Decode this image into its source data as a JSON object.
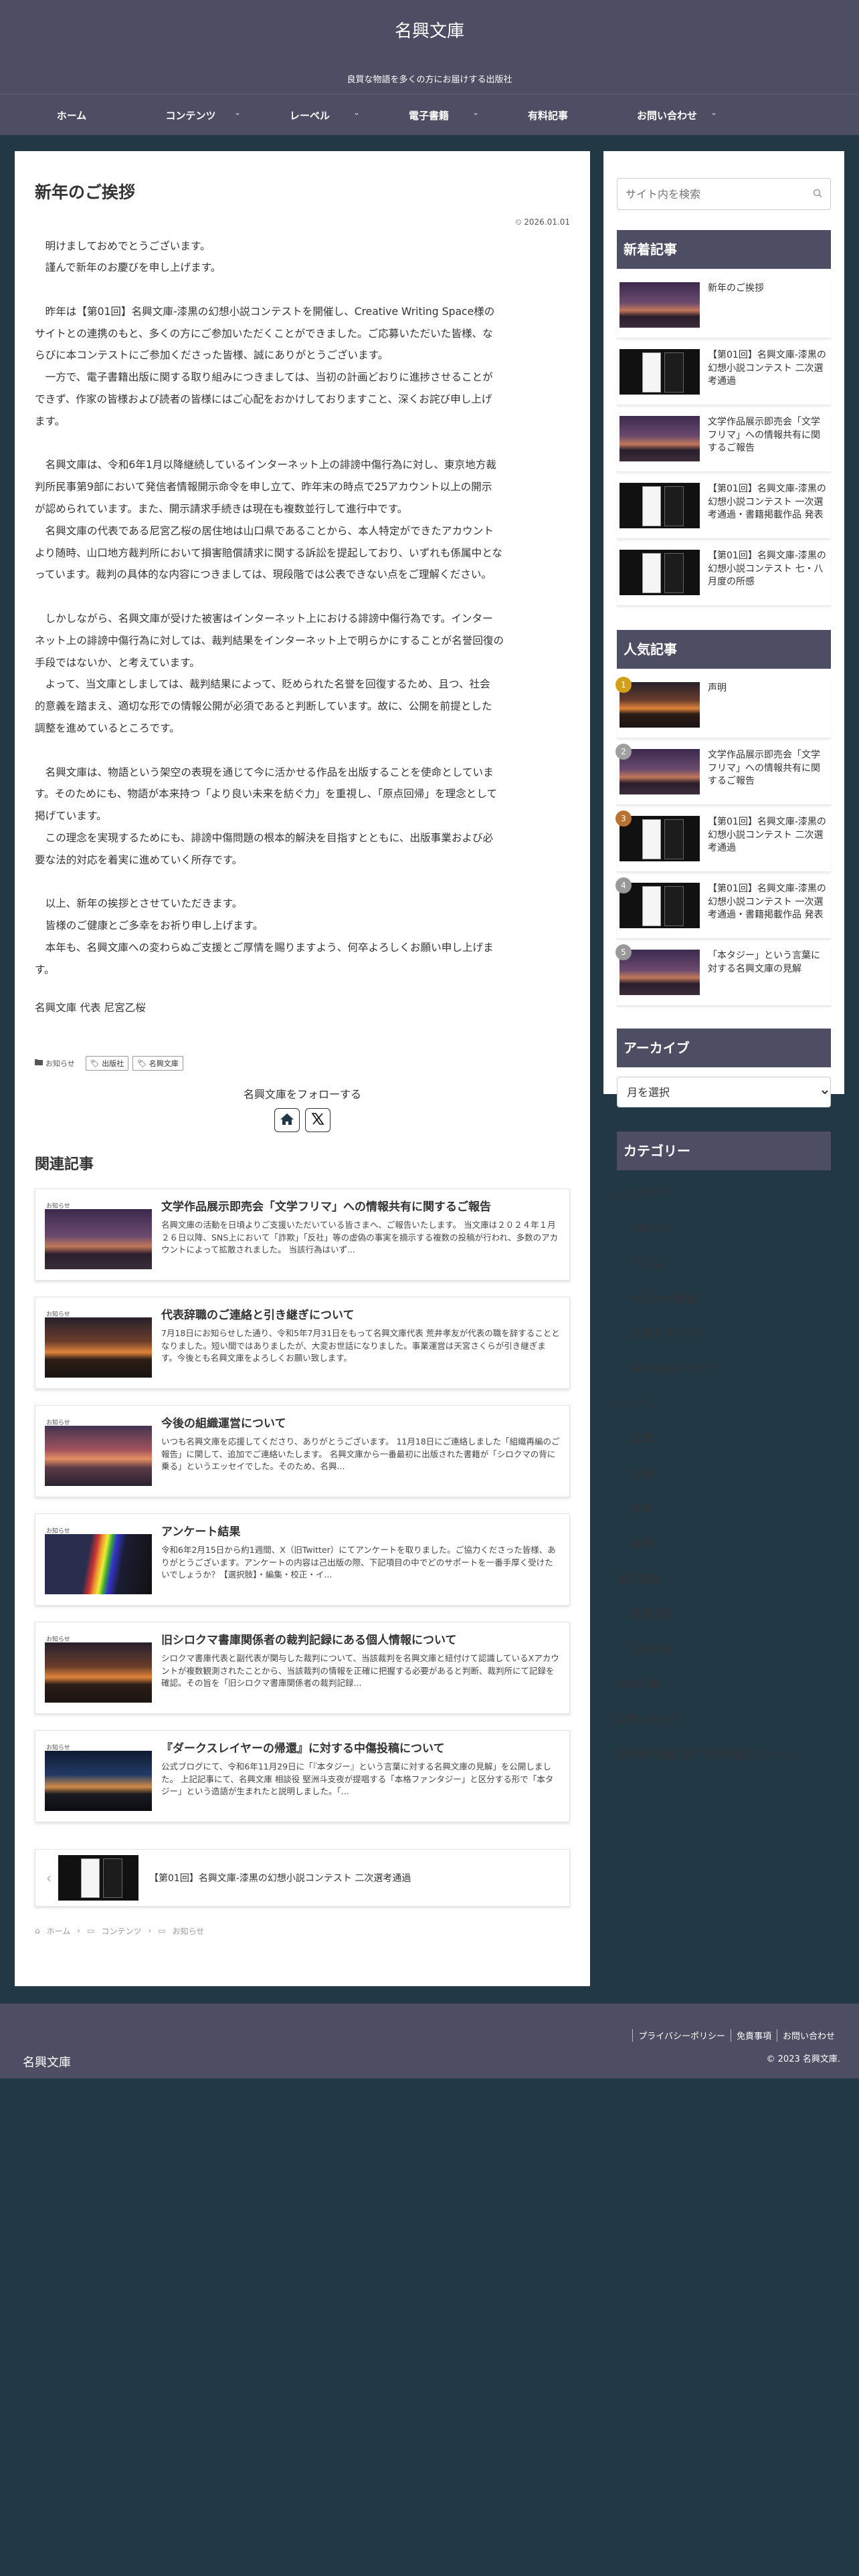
{
  "header": {
    "site_name": "名興文庫",
    "tagline": "良質な物語を多くの方にお届けする出版社"
  },
  "nav": [
    {
      "label": "ホーム",
      "has_sub": false
    },
    {
      "label": "コンテンツ",
      "has_sub": true
    },
    {
      "label": "レーベル",
      "has_sub": true
    },
    {
      "label": "電子書籍",
      "has_sub": true
    },
    {
      "label": "有料記事",
      "has_sub": false
    },
    {
      "label": "お問い合わせ",
      "has_sub": true
    }
  ],
  "article": {
    "title": "新年のご挨拶",
    "date": "2026.01.01",
    "lines": [
      "　明けましておめでとうございます。",
      "　謹んで新年のお慶びを申し上げます。",
      "",
      "　昨年は【第01回】名興文庫-漆黒の幻想小説コンテストを開催し、Creative Writing Space様の",
      "サイトとの連携のもと、多くの方にご参加いただくことができました。ご応募いただいた皆様、な",
      "らびに本コンテストにご参加くださった皆様、誠にありがとうございます。",
      "　一方で、電子書籍出版に関する取り組みにつきましては、当初の計画どおりに進捗させることが",
      "できず、作家の皆様および読者の皆様にはご心配をおかけしておりますこと、深くお詫び申し上げ",
      "ます。",
      "",
      "　名興文庫は、令和6年1月以降継続しているインターネット上の誹謗中傷行為に対し、東京地方裁",
      "判所民事第9部において発信者情報開示命令を申し立て、昨年末の時点で25アカウント以上の開示",
      "が認められています。また、開示請求手続きは現在も複数並行して進行中です。",
      "　名興文庫の代表である尼宮乙桜の居住地は山口県であることから、本人特定ができたアカウント",
      "より随時、山口地方裁判所において損害賠償請求に関する訴訟を提起しており、いずれも係属中とな",
      "っています。裁判の具体的な内容につきましては、現段階では公表できない点をご理解ください。",
      "",
      "　しかしながら、名興文庫が受けた被害はインターネット上における誹謗中傷行為です。インター",
      "ネット上の誹謗中傷行為に対しては、裁判結果をインターネット上で明らかにすることが名誉回復の",
      "手段ではないか、と考えています。",
      "　よって、当文庫としましては、裁判結果によって、貶められた名誉を回復するため、且つ、社会",
      "的意義を踏まえ、適切な形での情報公開が必須であると判断しています。故に、公開を前提とした",
      "調整を進めているところです。",
      "",
      "　名興文庫は、物語という架空の表現を通じて今に活かせる作品を出版することを使命としていま",
      "す。そのためにも、物語が本来持つ「より良い未来を紡ぐ力」を重視し、「原点回帰」を理念として",
      "掲げています。",
      "　この理念を実現するためにも、誹謗中傷問題の根本的解決を目指すとともに、出版事業および必",
      "要な法的対応を着実に進めていく所存です。",
      "",
      "　以上、新年の挨拶とさせていただきます。",
      "　皆様のご健康とご多幸をお祈り申し上げます。",
      "　本年も、名興文庫への変わらぬご支援とご厚情を賜りますよう、何卒よろしくお願い申し上げま",
      "す。"
    ],
    "signature": "名興文庫 代表 尼宮乙桜",
    "category": "お知らせ",
    "tags": [
      "出版社",
      "名興文庫"
    ],
    "follow_label": "名興文庫をフォローする"
  },
  "related": {
    "heading": "関連記事",
    "items": [
      {
        "badge": "お知らせ",
        "title": "文学作品展示即売会「文学フリマ」への情報共有に関するご報告",
        "snippet": "名興文庫の活動を日頃よりご支援いただいている皆さまへ、ご報告いたします。 当文庫は２０２４年１月２６日以降、SNS上において「詐欺」「反社」等の虚偽の事実を摘示する複数の投稿が行われ、多数のアカウントによって拡散されました。 当該行為はいず...",
        "thumb": "dusk"
      },
      {
        "badge": "お知らせ",
        "title": "代表辞職のご連絡と引き継ぎについて",
        "snippet": "7月18日にお知らせした通り、令和5年7月31日をもって名興文庫代表 荒井孝友が代表の職を辞することとなりました。短い間ではありましたが、大変お世話になりました。事業運営は天宮さくらが引き継ぎます。今後とも名興文庫をよろしくお願い致します。",
        "thumb": "sunset"
      },
      {
        "badge": "お知らせ",
        "title": "今後の組織運営について",
        "snippet": "いつも名興文庫を応援してくださり、ありがとうございます。 11月18日にご連絡しました「組織再編のご報告」に関して、追加でご連絡いたします。 名興文庫から一番最初に出版された書籍が「シロクマの背に乗る」というエッセイでした。そのため、名興...",
        "thumb": "beach"
      },
      {
        "badge": "お知らせ",
        "title": "アンケート結果",
        "snippet": "令和6年2月15日から約1週間、X（旧Twitter）にてアンケートを取りました。ご協力くださった皆様、ありがとうございます。アンケートの内容は己出版の際、下記項目の中でどのサポートを一番手厚く受けたいでしょうか？【選択肢】・編集・校正・イ...",
        "thumb": "rainbow"
      },
      {
        "badge": "お知らせ",
        "title": "旧シロクマ書庫関係者の裁判記録にある個人情報について",
        "snippet": "シロクマ書庫代表と副代表が関与した裁判について、当該裁判を名興文庫と紐付けて認識しているXアカウントが複数観測されたことから、当該裁判の情報を正確に把握する必要があると判断、裁判所にて記録を確認。その旨を「旧シロクマ書庫関係者の裁判記録...",
        "thumb": "sunset"
      },
      {
        "badge": "お知らせ",
        "title": "『ダークスレイヤーの帰還』に対する中傷投稿について",
        "snippet": "公式ブログにて、令和6年11月29日に「『本タジー』という言葉に対する名興文庫の見解」を公開しました。 上記記事にて、名興文庫 相談役 堅洲斗支夜が提唱する「本格ファンタジー」と区分する形で「本タジー」という造語が生まれたと説明しました。「...",
        "thumb": "tower"
      }
    ]
  },
  "prev_post": {
    "title": "【第01回】名興文庫-漆黒の幻想小説コンテスト 二次選考通過"
  },
  "breadcrumb": [
    "ホーム",
    "コンテンツ",
    "お知らせ"
  ],
  "sidebar": {
    "search_placeholder": "サイト内を検索",
    "recent_heading": "新着記事",
    "recent": [
      {
        "title": "新年のご挨拶",
        "thumb": "dusk"
      },
      {
        "title": "【第01回】名興文庫-漆黒の幻想小説コンテスト 二次選考通過",
        "thumb": "book"
      },
      {
        "title": "文学作品展示即売会「文学フリマ」への情報共有に関するご報告",
        "thumb": "dusk"
      },
      {
        "title": "【第01回】名興文庫-漆黒の幻想小説コンテスト 一次選考通過・書籍掲載作品 発表",
        "thumb": "book"
      },
      {
        "title": "【第01回】名興文庫-漆黒の幻想小説コンテスト 七・八月度の所感",
        "thumb": "book"
      }
    ],
    "popular_heading": "人気記事",
    "popular": [
      {
        "rank": "1",
        "title": "声明",
        "thumb": "sunset",
        "color": "#d4a017"
      },
      {
        "rank": "2",
        "title": "文学作品展示即売会「文学フリマ」への情報共有に関するご報告",
        "thumb": "dusk",
        "color": "#a0a0a0"
      },
      {
        "rank": "3",
        "title": "【第01回】名興文庫-漆黒の幻想小説コンテスト 二次選考通過",
        "thumb": "book",
        "color": "#b87333"
      },
      {
        "rank": "4",
        "title": "【第01回】名興文庫-漆黒の幻想小説コンテスト 一次選考通過・書籍掲載作品 発表",
        "thumb": "book",
        "color": "#999999"
      },
      {
        "rank": "5",
        "title": "「本タジー」という言葉に対する名興文庫の見解",
        "thumb": "dusk",
        "color": "#999999"
      }
    ],
    "archive_heading": "アーカイブ",
    "archive_select": "月を選択",
    "category_heading": "カテゴリー",
    "categories": [
      {
        "label": "コンテンツ",
        "sub": false
      },
      {
        "label": "お知らせ",
        "sub": true
      },
      {
        "label": "コラム",
        "sub": true
      },
      {
        "label": "YouTube動画",
        "sub": true
      },
      {
        "label": "出版までの流れ",
        "sub": true
      },
      {
        "label": "持ち込みについて",
        "sub": true
      },
      {
        "label": "レーベル",
        "sub": false
      },
      {
        "label": "漆黒",
        "sub": true
      },
      {
        "label": "紅梅",
        "sub": true
      },
      {
        "label": "翡翠",
        "sub": true
      },
      {
        "label": "瑠璃",
        "sub": true
      },
      {
        "label": "電子書籍",
        "sub": false
      },
      {
        "label": "漆黒作品",
        "sub": true
      },
      {
        "label": "紅梅作品",
        "sub": true
      },
      {
        "label": "有料記事",
        "sub": false
      },
      {
        "label": "お問い合わせ",
        "sub": false
      },
      {
        "label": "有料創作論に関する情報提供フォーム",
        "sub": false
      }
    ]
  },
  "footer": {
    "links": [
      "プライバシーポリシー",
      "免責事項",
      "お問い合わせ"
    ],
    "copyright": "© 2023 名興文庫.",
    "logo": "名興文庫"
  },
  "colors": {
    "nav_bg": "#4d4d63",
    "page_bg": "#223845",
    "heading_bg": "#4d4d63"
  }
}
